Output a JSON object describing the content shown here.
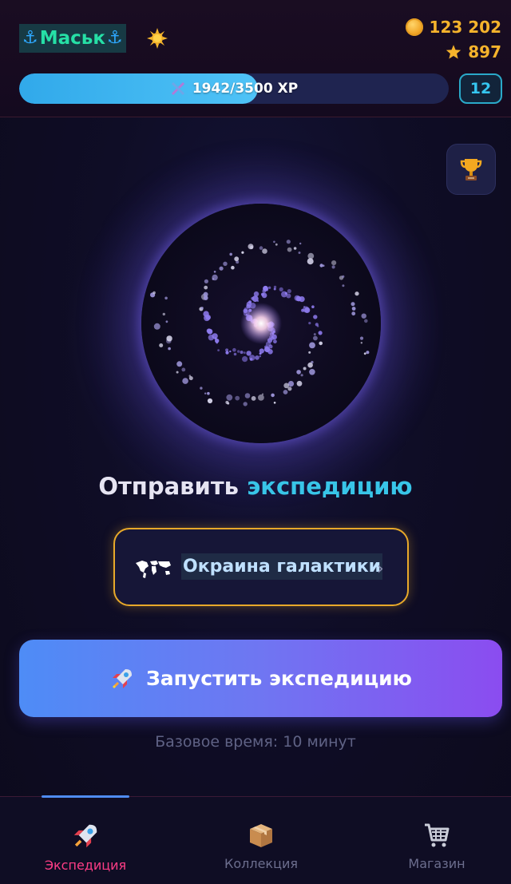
{
  "header": {
    "username": "Маськ",
    "coins": "123 202",
    "stars": "897",
    "xp_text": "1942/3500 XP",
    "xp_progress": 0.555,
    "level": "12"
  },
  "main": {
    "title_part1": "Отправить",
    "title_part2": "экспедицию",
    "destination": "Окраина галактики",
    "launch_label": "Запустить экспедицию",
    "base_time": "Базовое время: 10 минут"
  },
  "nav": {
    "items": [
      {
        "label": "Экспедиция",
        "icon": "rocket-icon",
        "active": true
      },
      {
        "label": "Коллекция",
        "icon": "box-icon",
        "active": false
      },
      {
        "label": "Магазин",
        "icon": "cart-icon",
        "active": false
      }
    ]
  },
  "colors": {
    "accent_cyan": "#38c5e8",
    "gold": "#f5b32c",
    "active_nav": "#ff3d86",
    "username": "#26e0a6"
  }
}
